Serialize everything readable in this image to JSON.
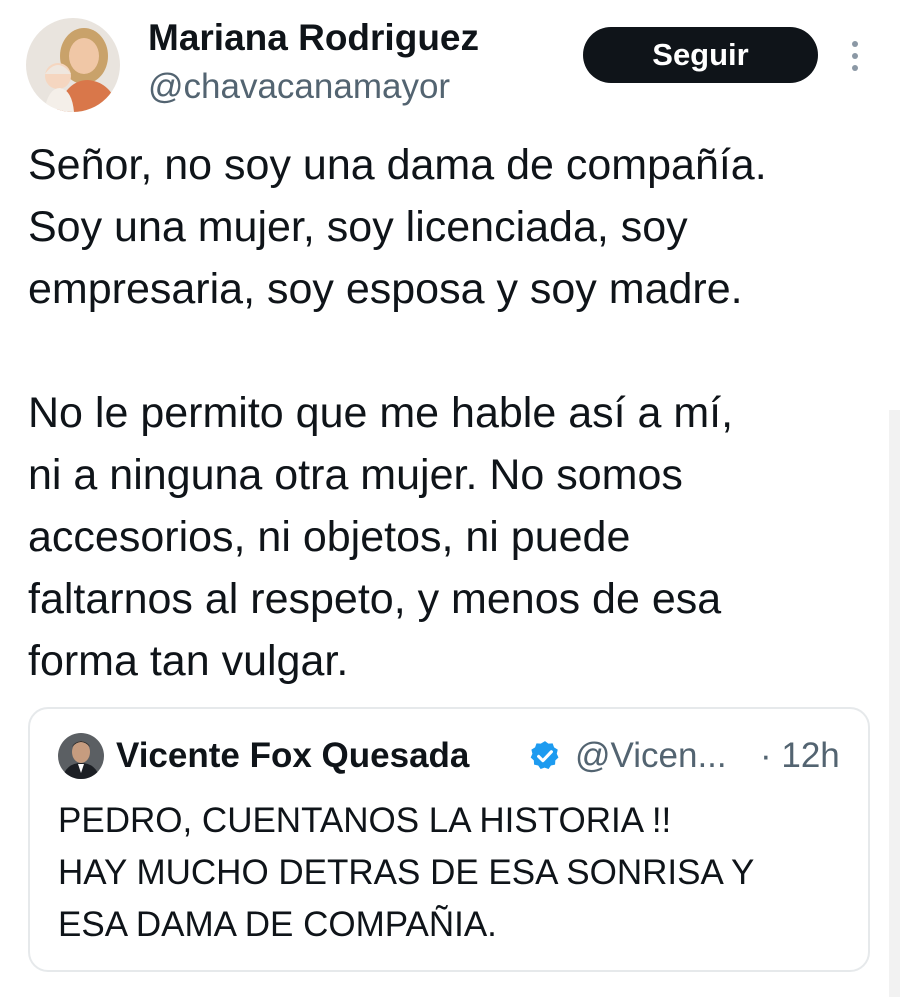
{
  "tweet": {
    "author_name": "Mariana Rodriguez",
    "author_handle": "@chavacanamayor",
    "follow_label": "Seguir",
    "paragraphs": [
      [
        "Señor, no soy una dama de compañía.",
        "Soy una mujer, soy licenciada, soy",
        "empresaria, soy esposa y soy madre."
      ],
      [
        "No le permito que me hable así a mí,",
        "ni a ninguna otra mujer. No somos",
        "accesorios, ni objetos, ni puede",
        "faltarnos al respeto, y menos de esa",
        "forma tan vulgar."
      ]
    ]
  },
  "quoted_tweet": {
    "author_name": "Vicente Fox Quesada",
    "author_handle": "@Vicen...",
    "time": "· 12h",
    "lines": [
      "PEDRO, CUENTANOS LA HISTORIA !!",
      "HAY MUCHO DETRAS DE ESA SONRISA Y",
      "ESA DAMA DE COMPAÑIA."
    ]
  },
  "icons": {
    "more": "more-vertical-icon",
    "verified": "verified-badge-icon"
  },
  "colors": {
    "text": "#0f1419",
    "secondary_text": "#536471",
    "follow_button_bg": "#0f1419",
    "verified_blue": "#1d9bf0",
    "border": "#e6e9eb"
  }
}
